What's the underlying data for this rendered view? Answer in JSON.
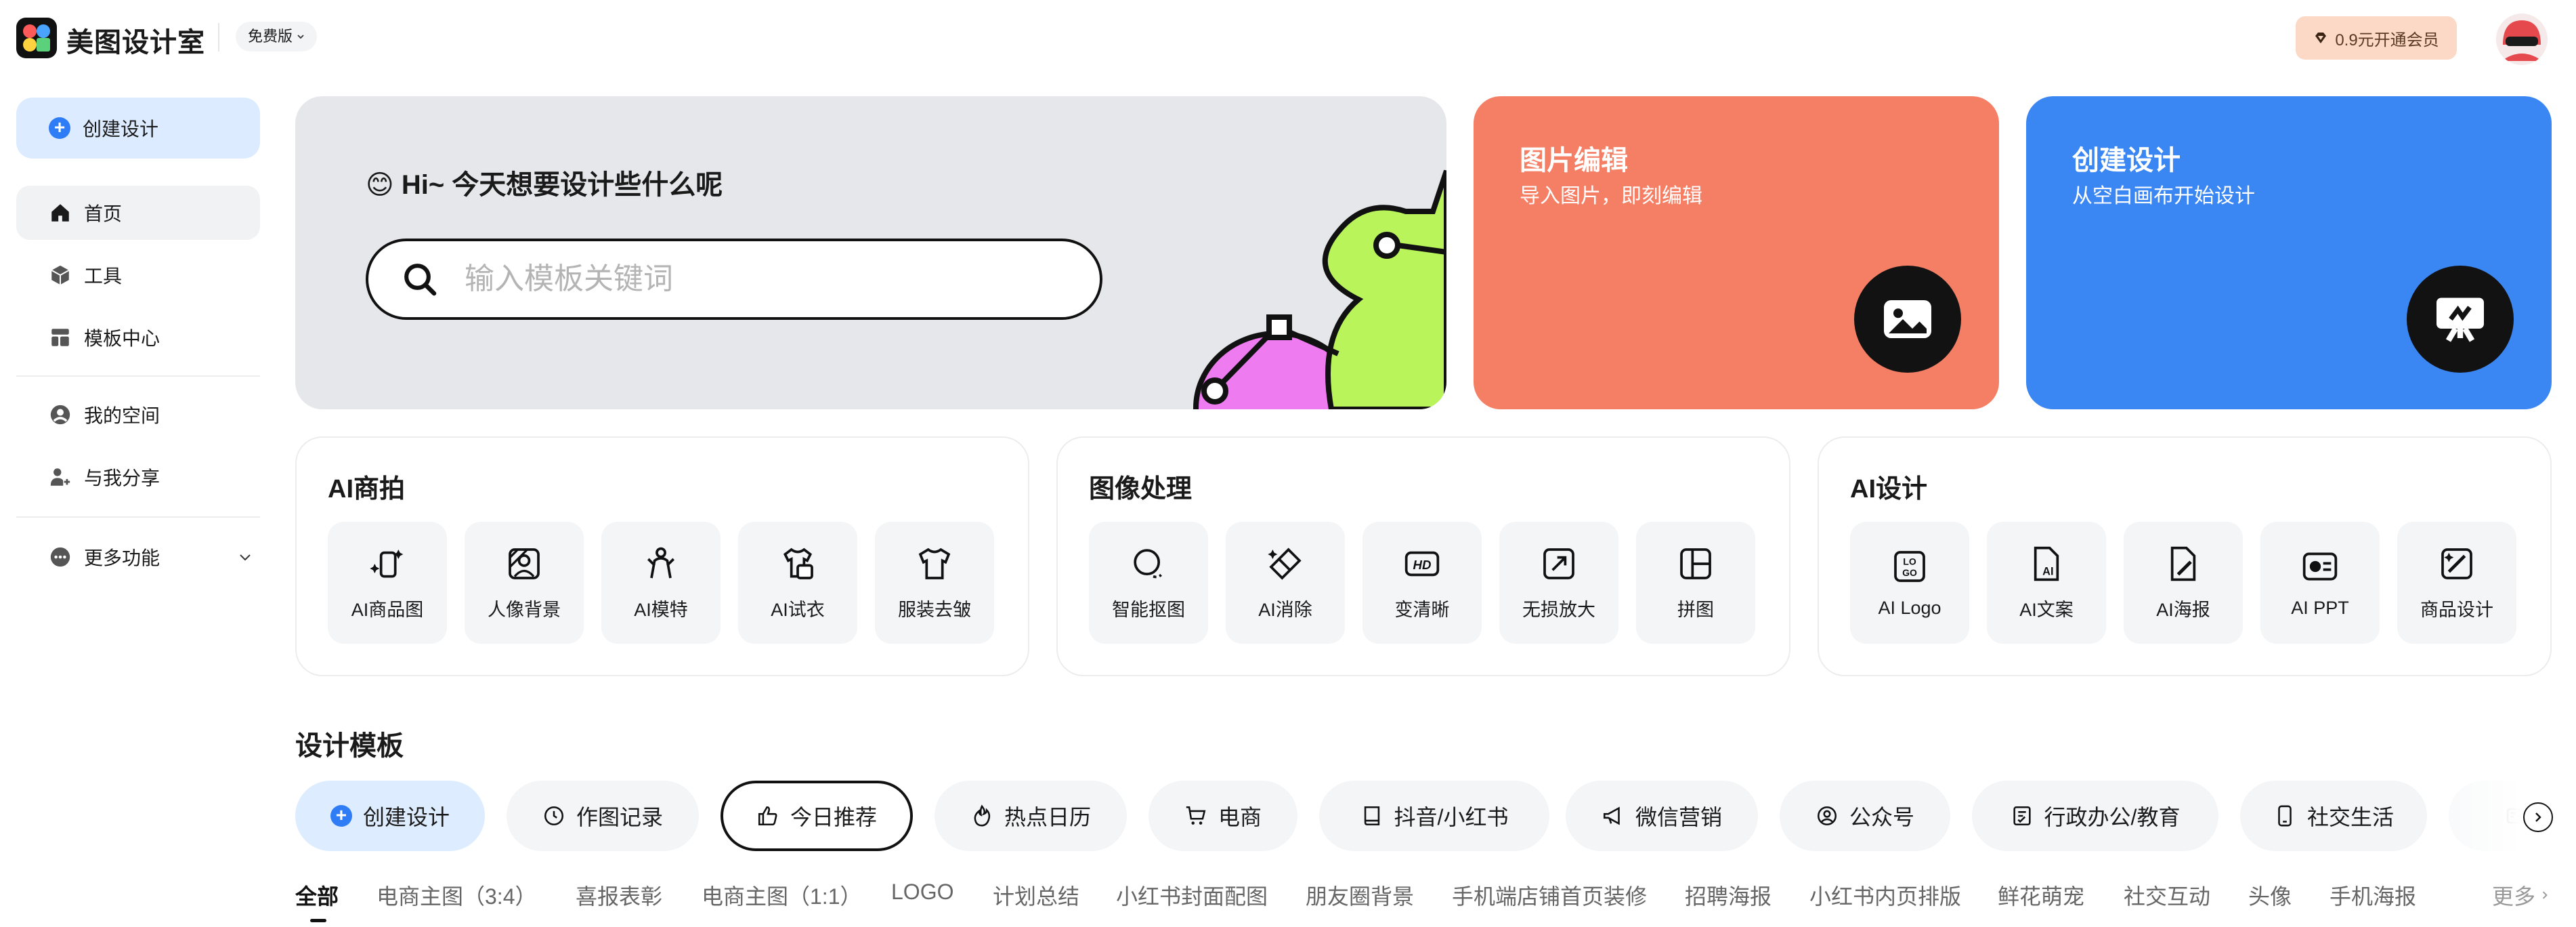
{
  "header": {
    "brand": "美图设计室",
    "plan": "免费版",
    "vip": "0.9元开通会员"
  },
  "sidebar": {
    "create": "创建设计",
    "items": [
      {
        "label": "首页",
        "icon": "home-icon"
      },
      {
        "label": "工具",
        "icon": "cube-icon"
      },
      {
        "label": "模板中心",
        "icon": "template-icon"
      },
      {
        "label": "我的空间",
        "icon": "user-circle-icon"
      },
      {
        "label": "与我分享",
        "icon": "user-share-icon"
      },
      {
        "label": "更多功能",
        "icon": "more-icon"
      }
    ]
  },
  "hero": {
    "greeting": "😊 Hi~ 今天想要设计些什么呢",
    "search_placeholder": "输入模板关键词"
  },
  "cards": {
    "edit": {
      "title": "图片编辑",
      "subtitle": "导入图片，即刻编辑"
    },
    "create": {
      "title": "创建设计",
      "subtitle": "从空白画布开始设计"
    }
  },
  "panels": [
    {
      "title": "AI商拍",
      "tools": [
        "AI商品图",
        "人像背景",
        "AI模特",
        "AI试衣",
        "服装去皱"
      ]
    },
    {
      "title": "图像处理",
      "tools": [
        "智能抠图",
        "AI消除",
        "变清晰",
        "无损放大",
        "拼图"
      ]
    },
    {
      "title": "AI设计",
      "tools": [
        "AI Logo",
        "AI文案",
        "AI海报",
        "AI PPT",
        "商品设计"
      ]
    }
  ],
  "templates": {
    "title": "设计模板",
    "chips": [
      "创建设计",
      "作图记录",
      "今日推荐",
      "热点日历",
      "电商",
      "抖音/小红书",
      "微信营销",
      "公众号",
      "行政办公/教育",
      "社交生活"
    ],
    "categories": [
      "全部",
      "电商主图（3:4）",
      "喜报表彰",
      "电商主图（1:1）",
      "LOGO",
      "计划总结",
      "小红书封面配图",
      "朋友圈背景",
      "手机端店铺首页装修",
      "招聘海报",
      "小红书内页排版",
      "鲜花萌宠",
      "社交互动",
      "头像",
      "手机海报"
    ],
    "more": "更多"
  },
  "colors": {
    "accent_blue": "#3a86f3",
    "edit_card": "#f47f64",
    "vip_bg": "#fbd9c6"
  }
}
